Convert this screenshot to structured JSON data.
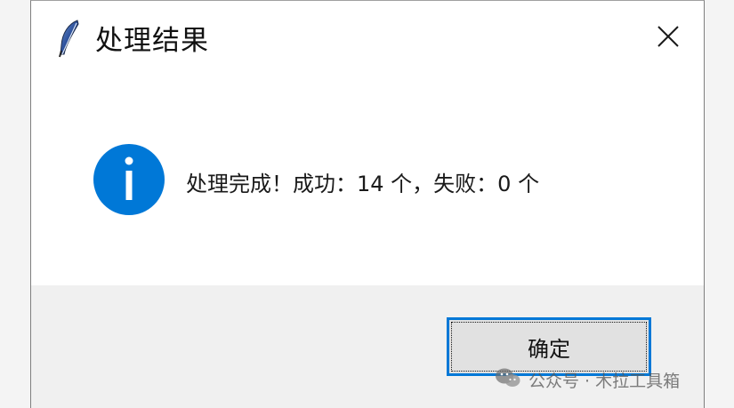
{
  "window": {
    "title": "处理结果",
    "title_icon": "feather-icon",
    "close_icon": "close-icon"
  },
  "message": {
    "icon": "info-icon",
    "text": "处理完成！成功：14 个，失败：0 个"
  },
  "buttons": {
    "ok_label": "确定"
  },
  "watermark": {
    "icon": "wechat-icon",
    "text": "公众号 · 木拉工具箱"
  },
  "colors": {
    "info_icon": "#0078d7",
    "focus_border": "#0078d7",
    "footer_bg": "#f0f0f0",
    "button_bg": "#e1e1e1"
  }
}
